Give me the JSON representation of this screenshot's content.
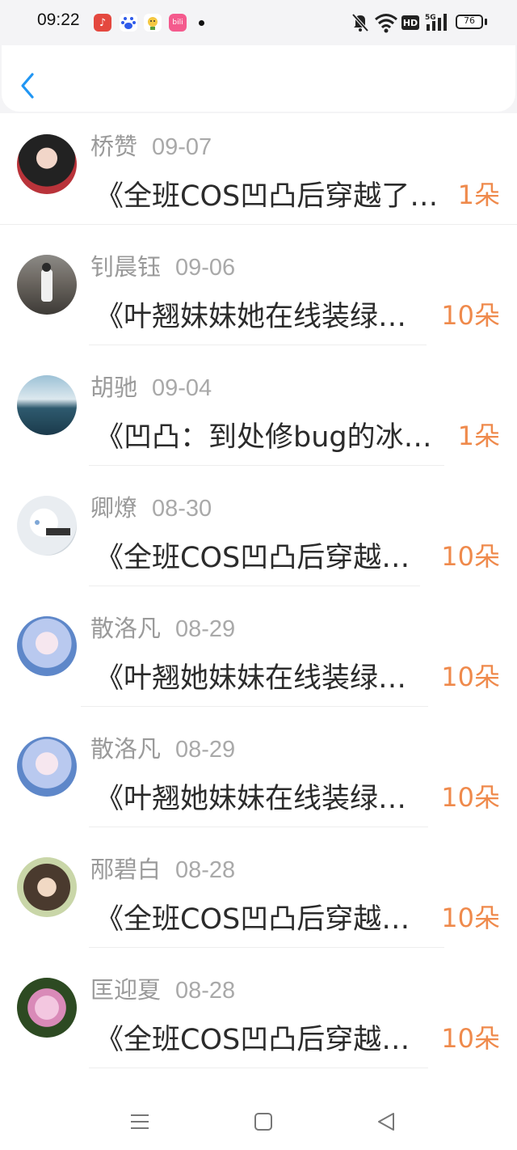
{
  "status_bar": {
    "time": "09:22",
    "battery": "76",
    "network": "5G",
    "hd": "HD",
    "icons": [
      "music-app-icon",
      "baidu-app-icon",
      "mascot-app-icon",
      "bilibili-app-icon",
      "notification-dot-icon",
      "mute-bell-icon",
      "wifi-icon",
      "hd-icon",
      "signal-icon",
      "battery-icon"
    ]
  },
  "header": {
    "back_icon": "chevron-left-icon",
    "accent": "#2196f3"
  },
  "list": {
    "items": [
      {
        "name": "桥赞",
        "date": "09-07",
        "title": "《全班COS凹凸后穿越了…",
        "amount": "1朵"
      },
      {
        "name": "钊晨钰",
        "date": "09-06",
        "title": "《叶翘妹妹她在线装绿…",
        "amount": "10朵"
      },
      {
        "name": "胡驰",
        "date": "09-04",
        "title": "《凹凸：到处修bug的冰…",
        "amount": "1朵"
      },
      {
        "name": "卿燎",
        "date": "08-30",
        "title": "《全班COS凹凸后穿越…",
        "amount": "10朵"
      },
      {
        "name": "散洛凡",
        "date": "08-29",
        "title": "《叶翘她妹妹在线装绿…",
        "amount": "10朵"
      },
      {
        "name": "散洛凡",
        "date": "08-29",
        "title": "《叶翘她妹妹在线装绿…",
        "amount": "10朵"
      },
      {
        "name": "邴碧白",
        "date": "08-28",
        "title": "《全班COS凹凸后穿越…",
        "amount": "10朵"
      },
      {
        "name": "匡迎夏",
        "date": "08-28",
        "title": "《全班COS凹凸后穿越…",
        "amount": "10朵"
      }
    ]
  },
  "nav_bar": {
    "icons": [
      "menu-icon",
      "home-square-icon",
      "back-triangle-icon"
    ]
  },
  "colors": {
    "amount": "#ef8a4c",
    "name": "#9a9a9a",
    "title": "#2b2b2b"
  }
}
